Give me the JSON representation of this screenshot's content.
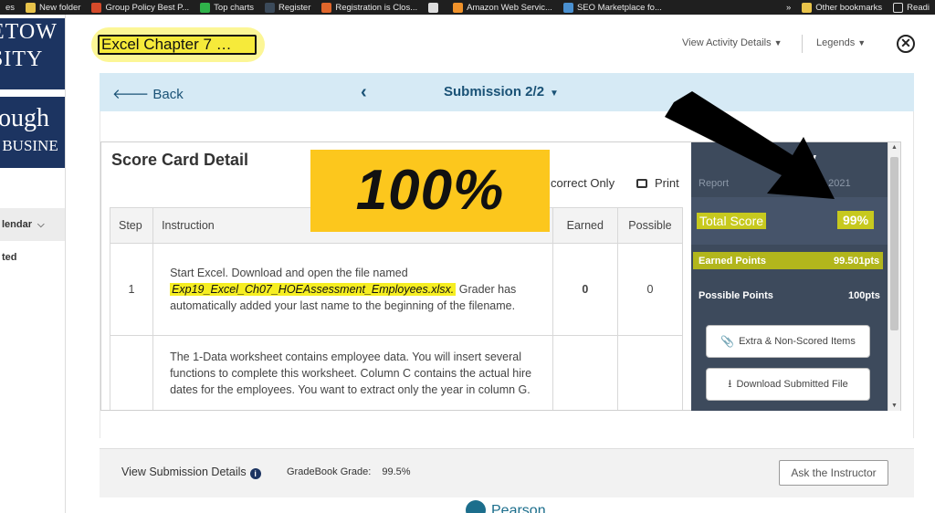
{
  "bookmarks": {
    "items": [
      {
        "label": "es",
        "color": ""
      },
      {
        "label": "New folder",
        "color": "#e8c34a"
      },
      {
        "label": "Group Policy Best P...",
        "color": "#d44a2a"
      },
      {
        "label": "Top charts",
        "color": "#2fb34a"
      },
      {
        "label": "Register",
        "color": "#3b4a5a"
      },
      {
        "label": "Registration is Clos...",
        "color": "#e0662b"
      },
      {
        "label": "",
        "color": "#dddddd"
      },
      {
        "label": "Amazon Web Servic...",
        "color": "#f0922b"
      },
      {
        "label": "SEO Marketplace fo...",
        "color": "#4a90d0"
      }
    ],
    "more": "»",
    "other": "Other bookmarks",
    "reading": "Readi"
  },
  "sidebar": {
    "logo1_line1": "ETOW",
    "logo1_line2": "SITY",
    "logo2_line1": "ough",
    "logo2_line2": "T BUSINE",
    "calendar_label": "lendar",
    "item2_label": "ted"
  },
  "header": {
    "title": "Excel Chapter 7 …",
    "view_activity": "View Activity Details",
    "legends": "Legends",
    "close": "✕"
  },
  "nav": {
    "back": "Back",
    "submission": "Submission 2/2"
  },
  "scorecard": {
    "title": "Score Card Detail",
    "correct_only": "correct Only",
    "print": "Print",
    "columns": {
      "step": "Step",
      "instruction": "Instruction",
      "earned": "Earned",
      "possible": "Possible"
    },
    "rows": [
      {
        "step": "1",
        "instruction_pre": "Start Excel. Download and open the file named",
        "instruction_file": "Exp19_Excel_Ch07_HOEAssessment_Employees.xlsx.",
        "instruction_post": "Grader has automatically added your last name to the beginning of the filename.",
        "earned": "0",
        "possible": "0"
      },
      {
        "step": "",
        "instruction_pre": "The 1-Data worksheet contains employee data. You will insert several functions to complete this worksheet. Column C contains the actual hire dates for the employees. You want to extract only the year in column G.",
        "instruction_file": "",
        "instruction_post": "",
        "earned": "",
        "possible": ""
      }
    ]
  },
  "overlay": {
    "big_percent": "100%"
  },
  "summary": {
    "title": "mary",
    "report": "Report",
    "date": ", 2021",
    "total_score_label": "Total Score",
    "total_score_value": "99%",
    "earned_label": "Earned Points",
    "earned_value": "99.501pts",
    "possible_label": "Possible Points",
    "possible_value": "100pts",
    "extra_button": "Extra & Non-Scored Items",
    "download_button": "Download Submitted File"
  },
  "footer": {
    "view_submission": "View Submission Details",
    "gradebook_label": "GradeBook Grade:",
    "gradebook_value": "99.5%",
    "ask_button": "Ask the Instructor"
  },
  "brand": {
    "name": "Pearson"
  },
  "colors": {
    "navy": "#1c3461",
    "nav_bg": "#d6eaf5",
    "summary_bg": "#3d4a5c",
    "highlight": "#f6ee22",
    "overlay_yellow": "#fcc71d"
  }
}
